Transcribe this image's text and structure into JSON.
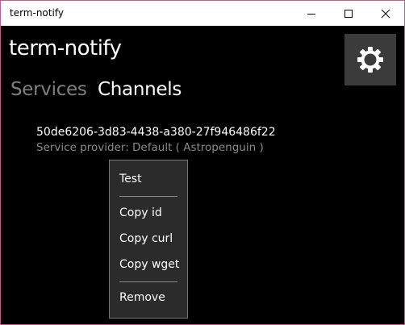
{
  "window": {
    "title": "term-notify"
  },
  "app": {
    "title": "term-notify"
  },
  "tabs": [
    {
      "label": "Services",
      "active": false
    },
    {
      "label": "Channels",
      "active": true
    }
  ],
  "channel": {
    "id": "50de6206-3d83-4438-a380-27f946486f22",
    "provider": "Service provider: Default ( Astropenguin )"
  },
  "context_menu": {
    "items": [
      "Test",
      "Copy id",
      "Copy curl",
      "Copy wget",
      "Remove"
    ]
  },
  "icons": {
    "settings": "gear-icon",
    "minimize": "minimize-icon",
    "maximize": "maximize-icon",
    "close": "close-icon"
  },
  "colors": {
    "window_border": "#c65a8c",
    "background": "#000000",
    "settings_button": "#3b3b3b",
    "menu_background": "#2b2b2b",
    "inactive_tab": "#7f7f7f",
    "secondary_text": "#8a8a8a"
  }
}
